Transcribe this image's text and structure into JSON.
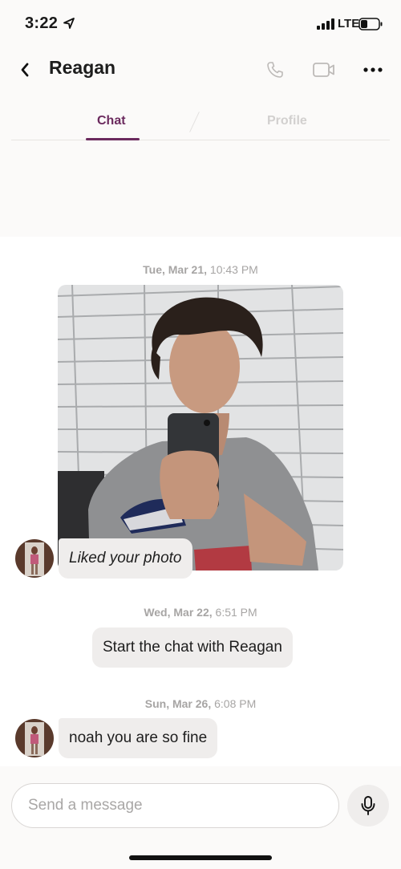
{
  "status_bar": {
    "time": "3:22",
    "network": "LTE",
    "icons": [
      "location-arrow-icon",
      "signal-icon",
      "battery-icon"
    ]
  },
  "header": {
    "contact_name": "Reagan",
    "icons": [
      "back-chevron-icon",
      "phone-icon",
      "video-camera-icon",
      "more-dots-icon"
    ]
  },
  "tabs": [
    {
      "label": "Chat",
      "active": true
    },
    {
      "label": "Profile",
      "active": false
    }
  ],
  "messages": {
    "group1": {
      "date_day": "Tue, Mar 21,",
      "date_time": " 10:43 PM",
      "liked_text": "Liked your photo"
    },
    "group2": {
      "date_day": "Wed, Mar 22,",
      "date_time": " 6:51 PM",
      "system_text": "Start the chat with Reagan"
    },
    "group3": {
      "date_day": "Sun, Mar 26,",
      "date_time": " 6:08 PM",
      "message_text": "noah you are so fine"
    }
  },
  "composer": {
    "placeholder": "Send a message",
    "mic_icon": "microphone-icon"
  },
  "colors": {
    "accent": "#6b2a5e",
    "bubble": "#efedec",
    "muted": "#a7a5a4"
  }
}
